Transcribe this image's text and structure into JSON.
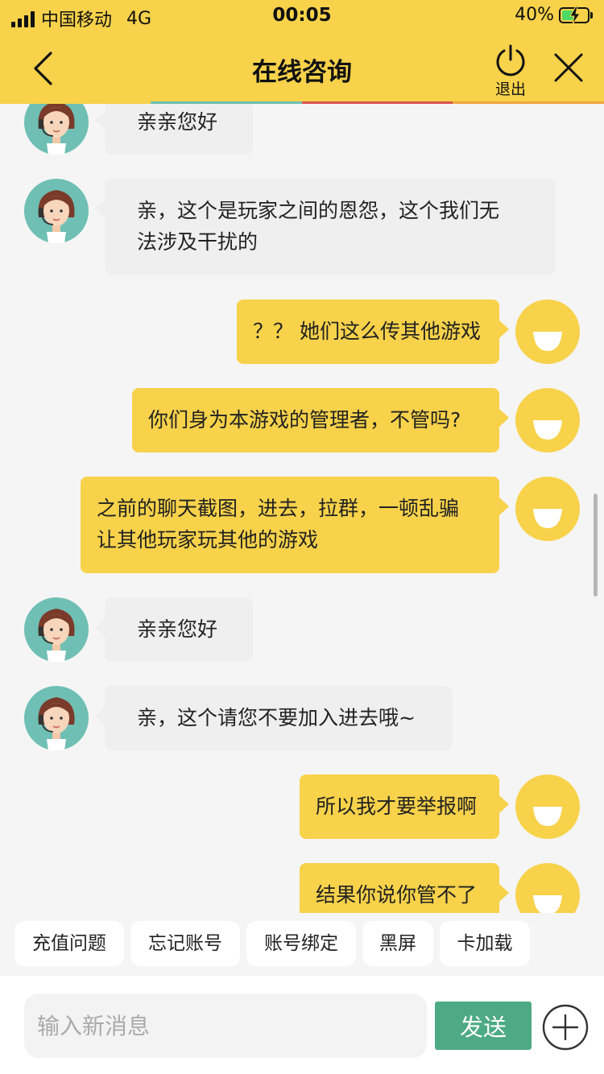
{
  "status_bar": {
    "carrier": "中国移动",
    "network": "4G",
    "time": "00:05",
    "battery": "40%"
  },
  "nav": {
    "title": "在线咨询",
    "exit_label": "退出"
  },
  "colors": {
    "brand_yellow": "#f7d24a",
    "send_green": "#4daa84",
    "agent_bubble": "#efefef"
  },
  "messages": [
    {
      "from": "agent",
      "text": "亲亲您好"
    },
    {
      "from": "agent",
      "text": "亲，这个是玩家之间的恩怨，这个我们无\n法涉及干扰的"
    },
    {
      "from": "user",
      "text": "？？ 她们这么传其他游戏"
    },
    {
      "from": "user",
      "text": "你们身为本游戏的管理者，不管吗?"
    },
    {
      "from": "user",
      "text": "之前的聊天截图，进去，拉群，一顿乱骗\n让其他玩家玩其他的游戏"
    },
    {
      "from": "agent",
      "text": "亲亲您好"
    },
    {
      "from": "agent",
      "text": "亲，这个请您不要加入进去哦~"
    },
    {
      "from": "user",
      "text": "所以我才要举报啊"
    },
    {
      "from": "user",
      "text": "结果你说你管不了"
    }
  ],
  "quick_replies": [
    "充值问题",
    "忘记账号",
    "账号绑定",
    "黑屏",
    "卡加载"
  ],
  "input": {
    "placeholder": "输入新消息",
    "send_label": "发送"
  }
}
